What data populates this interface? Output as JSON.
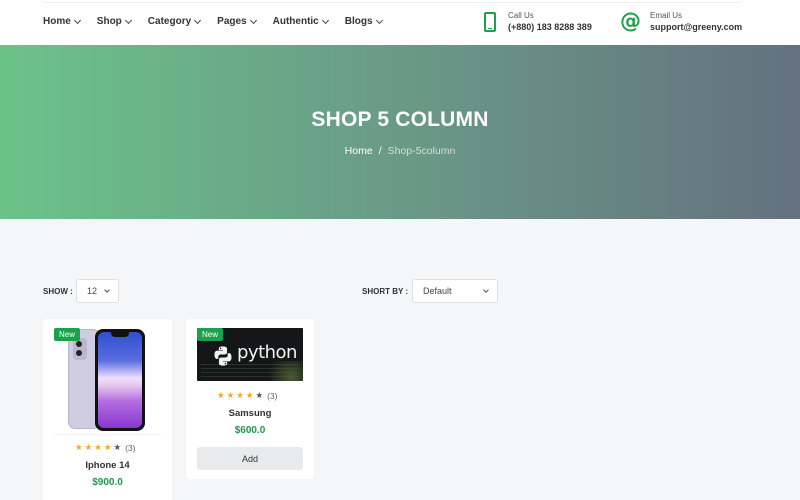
{
  "header": {
    "nav": [
      {
        "label": "Home"
      },
      {
        "label": "Shop"
      },
      {
        "label": "Category"
      },
      {
        "label": "Pages"
      },
      {
        "label": "Authentic"
      },
      {
        "label": "Blogs"
      }
    ],
    "call": {
      "label": "Call Us",
      "value": "(+880) 183 8288 389"
    },
    "email": {
      "label": "Email Us",
      "value": "support@greeny.com"
    }
  },
  "banner": {
    "title": "SHOP 5 COLUMN",
    "breadcrumb": {
      "home": "Home",
      "separator": "/",
      "current": "Shop-5column"
    }
  },
  "toolbar": {
    "show_label": "SHOW :",
    "show_value": "12",
    "sort_label": "SHORT BY :",
    "sort_value": "Default"
  },
  "products": [
    {
      "badge": "New",
      "name": "Iphone 14",
      "price": "$900.0",
      "rating": 4,
      "reviews": "(3)",
      "image": "iphone-purple"
    },
    {
      "badge": "New",
      "name": "Samsung",
      "price": "$600.0",
      "rating": 4,
      "reviews": "(3)",
      "image": "python-logo",
      "image_text": "python",
      "button": "Add"
    }
  ],
  "colors": {
    "accent": "#1aa14b",
    "price": "#1a9a47",
    "star": "#f4a623"
  }
}
